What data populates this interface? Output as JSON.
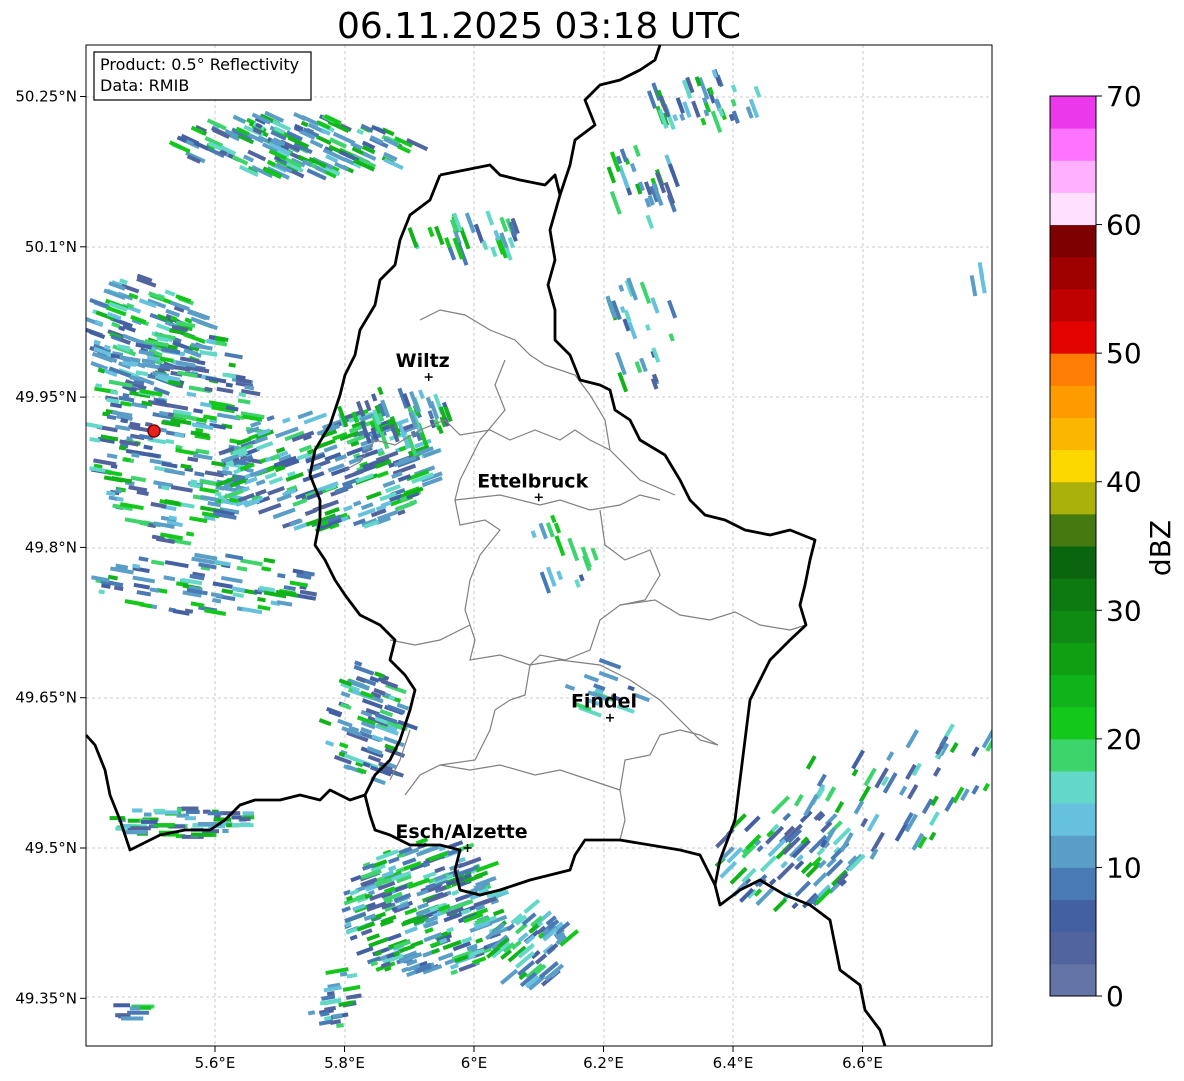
{
  "title": "06.11.2025 03:18 UTC",
  "info_box": {
    "line1": "Product: 0.5° Reflectivity",
    "line2": "Data: RMIB"
  },
  "axes": {
    "lon_ticks": [
      "5.6°E",
      "5.8°E",
      "6°E",
      "6.2°E",
      "6.4°E",
      "6.6°E"
    ],
    "lat_ticks": [
      "50.25°N",
      "50.1°N",
      "49.95°N",
      "49.8°N",
      "49.65°N",
      "49.5°N",
      "49.35°N"
    ],
    "grid": true
  },
  "cities": [
    {
      "name": "Wiltz",
      "lon": 5.93,
      "lat": 49.97
    },
    {
      "name": "Ettelbruck",
      "lon": 6.1,
      "lat": 49.85
    },
    {
      "name": "Findel",
      "lon": 6.21,
      "lat": 49.63
    },
    {
      "name": "Esch/Alzette",
      "lon": 5.99,
      "lat": 49.5
    }
  ],
  "radar_site": {
    "lon": 5.51,
    "lat": 49.92,
    "color": "#e8201e"
  },
  "colorbar": {
    "label": "dBZ",
    "min": 0,
    "max": 70,
    "tick_labels": [
      "0",
      "10",
      "20",
      "30",
      "40",
      "50",
      "60",
      "70"
    ],
    "colors": [
      "#6474a6",
      "#52649d",
      "#4360a2",
      "#4a7ab4",
      "#5a9dc6",
      "#65c1dd",
      "#63d8c8",
      "#3ed46c",
      "#13c81b",
      "#11b31a",
      "#109f12",
      "#0f8a12",
      "#0d7911",
      "#0b640e",
      "#447a10",
      "#aab10a",
      "#fdd700",
      "#fbb600",
      "#fd9b00",
      "#fe7d02",
      "#e20200",
      "#bf0102",
      "#9e0100",
      "#7d0101",
      "#ffe0ff",
      "#ffb1ff",
      "#ff73fe",
      "#ea38ea"
    ]
  }
}
